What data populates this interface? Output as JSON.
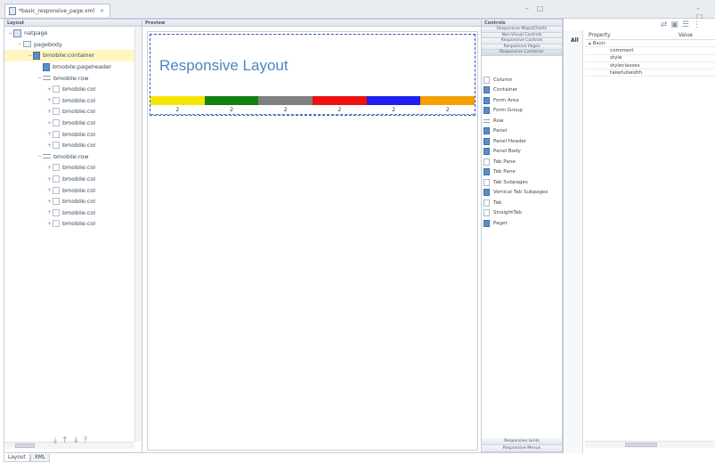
{
  "window": {
    "editor_tab_title": "*basic_responsive_page.xml",
    "editor_tab_close": "✕",
    "window_controls": "– □",
    "props_controls": "– □"
  },
  "layout_panel": {
    "title": "Layout",
    "tree": [
      {
        "label": "natpage",
        "icon": "page-icon",
        "expander": "−",
        "depth": 0,
        "selected": false
      },
      {
        "label": "pagebody",
        "icon": "body-icon",
        "expander": "−",
        "depth": 1,
        "selected": false
      },
      {
        "label": "bmobile:container",
        "icon": "container-icon",
        "expander": "−",
        "depth": 2,
        "selected": true
      },
      {
        "label": "bmobile:pageheader",
        "icon": "container-icon",
        "expander": "",
        "depth": 3,
        "selected": false
      },
      {
        "label": "bmobile:row",
        "icon": "row-icon",
        "expander": "−",
        "depth": 3,
        "selected": false
      },
      {
        "label": "bmobile:col",
        "icon": "col-icon",
        "expander": "+",
        "depth": 4,
        "selected": false
      },
      {
        "label": "bmobile:col",
        "icon": "col-icon",
        "expander": "+",
        "depth": 4,
        "selected": false
      },
      {
        "label": "bmobile:col",
        "icon": "col-icon",
        "expander": "+",
        "depth": 4,
        "selected": false
      },
      {
        "label": "bmobile:col",
        "icon": "col-icon",
        "expander": "+",
        "depth": 4,
        "selected": false
      },
      {
        "label": "bmobile:col",
        "icon": "col-icon",
        "expander": "+",
        "depth": 4,
        "selected": false
      },
      {
        "label": "bmobile:col",
        "icon": "col-icon",
        "expander": "+",
        "depth": 4,
        "selected": false
      },
      {
        "label": "bmobile:row",
        "icon": "row-icon",
        "expander": "−",
        "depth": 3,
        "selected": false
      },
      {
        "label": "bmobile:col",
        "icon": "col-icon",
        "expander": "+",
        "depth": 4,
        "selected": false
      },
      {
        "label": "bmobile:col",
        "icon": "col-icon",
        "expander": "+",
        "depth": 4,
        "selected": false
      },
      {
        "label": "bmobile:col",
        "icon": "col-icon",
        "expander": "+",
        "depth": 4,
        "selected": false
      },
      {
        "label": "bmobile:col",
        "icon": "col-icon",
        "expander": "+",
        "depth": 4,
        "selected": false
      },
      {
        "label": "bmobile:col",
        "icon": "col-icon",
        "expander": "+",
        "depth": 4,
        "selected": false
      },
      {
        "label": "bmobile:col",
        "icon": "col-icon",
        "expander": "+",
        "depth": 4,
        "selected": false
      }
    ],
    "tools": "⤓↑↓⤒"
  },
  "preview_panel": {
    "title": "Preview",
    "heading": "Responsive Layout",
    "columns": [
      {
        "color": "#f5e400",
        "label": "2"
      },
      {
        "color": "#118011",
        "label": "2"
      },
      {
        "color": "#808080",
        "label": "2"
      },
      {
        "color": "#f01010",
        "label": "2"
      },
      {
        "color": "#1f1ff0",
        "label": "2"
      },
      {
        "color": "#f5a000",
        "label": "2"
      }
    ]
  },
  "controls_panel": {
    "title": "Controls",
    "categories": [
      {
        "label": "Responsive Maps/Charts",
        "active": false
      },
      {
        "label": "Non-Visual Controls",
        "active": false
      },
      {
        "label": "Responsive Controls",
        "active": false
      },
      {
        "label": "Responsive Pages",
        "active": false
      },
      {
        "label": "Responsive Container",
        "active": true
      }
    ],
    "items": [
      {
        "label": "Column",
        "icon": "plain"
      },
      {
        "label": "Container",
        "icon": "blue"
      },
      {
        "label": "Form Area",
        "icon": "blue"
      },
      {
        "label": "Form Group",
        "icon": "blue"
      },
      {
        "label": "Row",
        "icon": "row"
      },
      {
        "label": "Panel",
        "icon": "blue"
      },
      {
        "label": "Panel Header",
        "icon": "blue"
      },
      {
        "label": "Panel Body",
        "icon": "blue"
      },
      {
        "label": "Tab Pane",
        "icon": "plain"
      },
      {
        "label": "Tab Pane",
        "icon": "blue"
      },
      {
        "label": "Tab Subpages",
        "icon": "plain"
      },
      {
        "label": "Vertical Tab Subpages",
        "icon": "blue"
      },
      {
        "label": "Tab",
        "icon": "plain"
      },
      {
        "label": "StraightTab",
        "icon": "plain"
      },
      {
        "label": "Pager",
        "icon": "blue"
      }
    ],
    "bottom_categories": [
      "Responsive Grids",
      "Responsive Menus"
    ]
  },
  "properties_panel": {
    "all_label": "All",
    "col_property": "Property",
    "col_value": "Value",
    "group_label": "▴ Basic",
    "rows": [
      "comment",
      "style",
      "styleclasses",
      "takefullwidth"
    ],
    "toolbar": "⇄▣☰⋮"
  },
  "bottom_tabs": [
    {
      "label": "Layout",
      "active": true
    },
    {
      "label": "XML",
      "active": false
    }
  ]
}
